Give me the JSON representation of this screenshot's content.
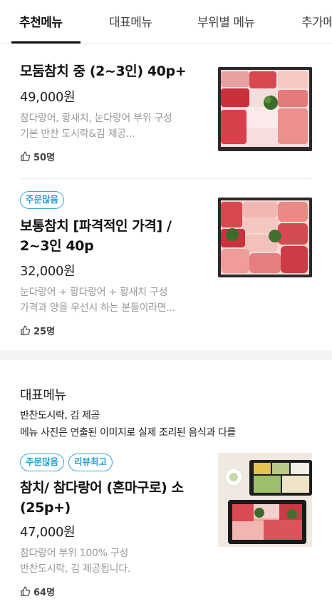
{
  "tabs": [
    {
      "label": "추천메뉴"
    },
    {
      "label": "대표메뉴"
    },
    {
      "label": "부위별 메뉴"
    },
    {
      "label": "추가메"
    }
  ],
  "items": [
    {
      "title_lines": [
        "모둠참치 중 (2~3인) 40p+"
      ],
      "price": "49,000원",
      "desc": [
        "참다랑어, 황새치, 눈다랑어 부위 구성",
        "기본 반찬 도시락&김 제공..."
      ],
      "likes": "50명"
    },
    {
      "badges": [
        "주문많음"
      ],
      "title_lines": [
        "보통참치 [파격적인 가격] /",
        "2~3인 40p"
      ],
      "price": "32,000원",
      "desc": [
        "눈다랑어 + 황다랑어 + 황새치 구성",
        "가격과 양을 우선시 하는 분들이라면..."
      ],
      "likes": "25명"
    },
    {
      "badges": [
        "주문많음",
        "리뷰최고"
      ],
      "title_lines": [
        "참치/ 참다랑어 (혼마구로) 소",
        "(25p+)"
      ],
      "price": "47,000원",
      "desc": [
        "참다랑어 부위 100% 구성",
        "반찬도시락, 김 제공됩니다."
      ],
      "likes": "64명"
    }
  ],
  "section": {
    "title": "대표메뉴",
    "lines": [
      "반찬도시락, 김 제공",
      "메뉴 사진은 연출된 이미지로 실제 조리된 음식과 다를"
    ]
  },
  "icons": {
    "like": "thumbs-up-icon"
  },
  "colors": {
    "badge": "#2a9ccf",
    "tab_active": "#111111"
  }
}
